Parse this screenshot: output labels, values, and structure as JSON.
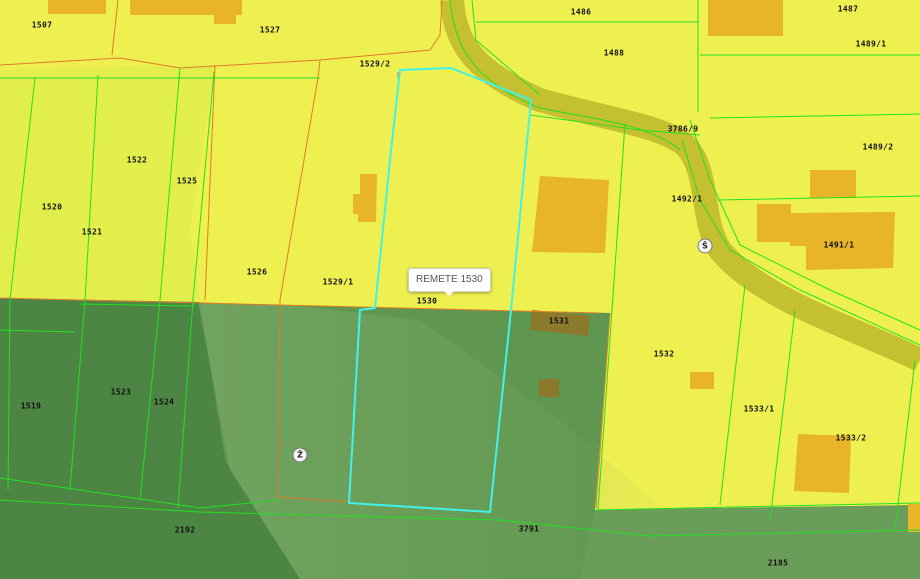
{
  "popup": {
    "label": "REMETE 1530"
  },
  "markers": {
    "z": "Ž",
    "s": "Š"
  },
  "parcels": {
    "p1507": "1507",
    "p1527": "1527",
    "p1486": "1486",
    "p1487": "1487",
    "p1488": "1488",
    "p1489_1": "1489/1",
    "p1529_2": "1529/2",
    "p3786_9": "3786/9",
    "p1489_2": "1489/2",
    "p1522": "1522",
    "p1525": "1525",
    "p1520": "1520",
    "p1521": "1521",
    "p1492_1": "1492/1",
    "p1491_1": "1491/1",
    "p1526": "1526",
    "p1529_1": "1529/1",
    "p1530": "1530",
    "p1531": "1531",
    "p1532": "1532",
    "p1519": "1519",
    "p1523": "1523",
    "p1524": "1524",
    "p1533_1": "1533/1",
    "p1533_2": "1533/2",
    "p2192": "2192",
    "p3791": "3791",
    "p2185": "2185"
  },
  "colors": {
    "zone_yellow": "#eef050",
    "zone_yellow_light": "#f2f264",
    "zone_green": "#5f9650",
    "zone_green_dark": "#4d8544",
    "building": "#e8b428",
    "road": "#c4c030",
    "parcel_line": "#22e022",
    "boundary_orange": "#e27b2a",
    "selection": "#3ff3e8"
  }
}
